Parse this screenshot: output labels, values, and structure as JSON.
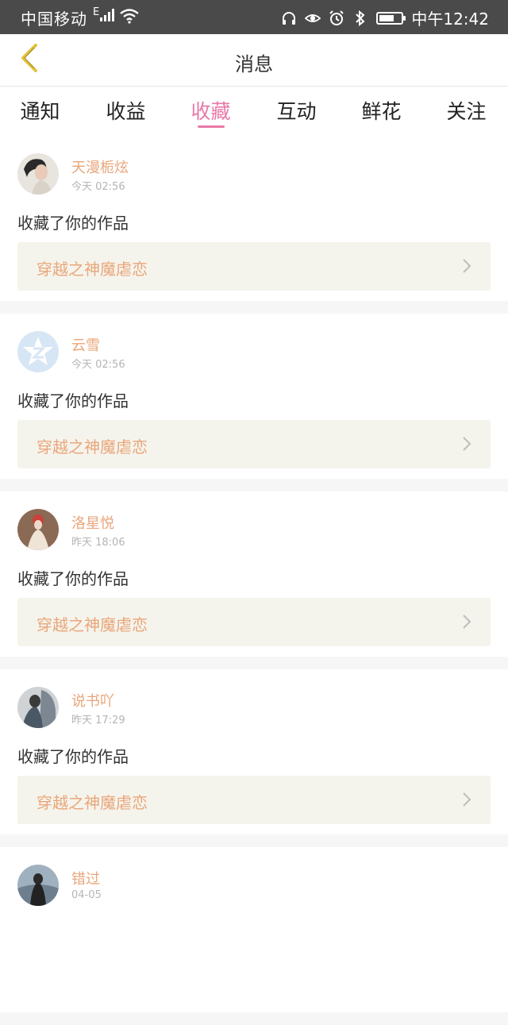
{
  "status_bar": {
    "carrier": "中国移动",
    "network": "E",
    "time": "中午12:42"
  },
  "header": {
    "title": "消息"
  },
  "tabs": [
    {
      "label": "通知",
      "active": false
    },
    {
      "label": "收益",
      "active": false
    },
    {
      "label": "收藏",
      "active": true
    },
    {
      "label": "互动",
      "active": false
    },
    {
      "label": "鲜花",
      "active": false
    },
    {
      "label": "关注",
      "active": false
    }
  ],
  "colors": {
    "accent_pink": "#e879a7",
    "name_orange": "#e9a67b",
    "card_bg": "#f5f4ec",
    "status_bar": "#4a4a4a"
  },
  "messages": [
    {
      "user": "天漫栀炫",
      "time": "今天  02:56",
      "action": "收藏了你的作品",
      "work": "穿越之神魔虐恋"
    },
    {
      "user": "云雪",
      "time": "今天  02:56",
      "action": "收藏了你的作品",
      "work": "穿越之神魔虐恋"
    },
    {
      "user": "洛星悦",
      "time": "昨天  18:06",
      "action": "收藏了你的作品",
      "work": "穿越之神魔虐恋"
    },
    {
      "user": "说书吖",
      "time": "昨天  17:29",
      "action": "收藏了你的作品",
      "work": "穿越之神魔虐恋"
    },
    {
      "user": "错过",
      "time": "04-05",
      "action": "",
      "work": ""
    }
  ]
}
